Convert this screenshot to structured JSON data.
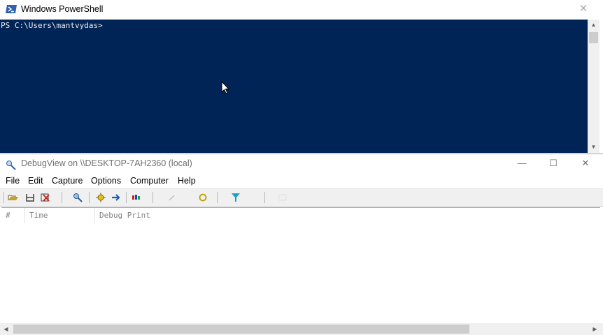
{
  "powershell": {
    "title": "Windows PowerShell",
    "prompt": "PS C:\\Users\\mantvydas>",
    "colors": {
      "console_bg": "#012456",
      "console_fg": "#eeedf0"
    },
    "icons": {
      "app": "powershell-icon",
      "close": "close-icon"
    }
  },
  "debugview": {
    "title": "DebugView on \\\\DESKTOP-7AH2360 (local)",
    "menu": [
      "File",
      "Edit",
      "Capture",
      "Options",
      "Computer",
      "Help"
    ],
    "toolbar_icons": [
      "open-icon",
      "save-icon",
      "clear-icon",
      "find-icon",
      "capture-icon",
      "scroll-icon",
      "clock-icon",
      "history-icon",
      "highlight-icon",
      "filter-icon",
      "log-icon"
    ],
    "columns": [
      "#",
      "Time",
      "Debug Print"
    ],
    "icons": {
      "app": "debugview-icon",
      "minimize": "minimize-icon",
      "maximize": "maximize-icon",
      "close": "close-icon"
    }
  }
}
